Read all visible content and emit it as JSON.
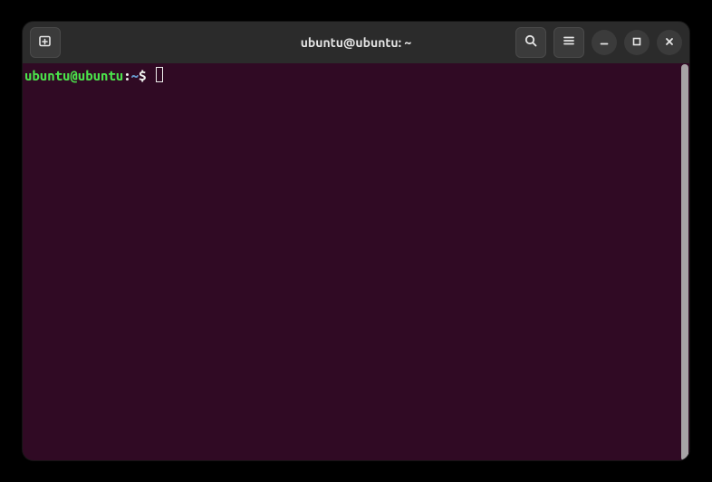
{
  "window": {
    "title": "ubuntu@ubuntu: ~"
  },
  "icons": {
    "new_tab": "new-tab",
    "search": "search",
    "menu": "menu",
    "minimize": "minimize",
    "maximize": "maximize",
    "close": "close"
  },
  "prompt": {
    "user_host": "ubuntu@ubuntu",
    "colon": ":",
    "path": "~",
    "symbol": "$",
    "input": ""
  }
}
